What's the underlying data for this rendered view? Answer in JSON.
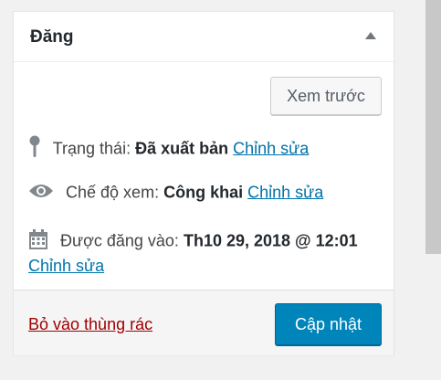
{
  "box": {
    "title": "Đăng",
    "toggle_icon": "triangle-up-icon"
  },
  "actions": {
    "preview_label": "Xem trước"
  },
  "status": {
    "icon": "pin-icon",
    "label": "Trạng thái:",
    "value": "Đã xuất bản",
    "edit_label": "Chỉnh sửa"
  },
  "visibility": {
    "icon": "eye-icon",
    "label": "Chế độ xem:",
    "value": "Công khai",
    "edit_label": "Chỉnh sửa"
  },
  "publish_date": {
    "icon": "calendar-icon",
    "label": "Được đăng vào:",
    "value": "Th10 29, 2018 @ 12:01",
    "edit_label": "Chỉnh sửa"
  },
  "footer": {
    "trash_label": "Bỏ vào thùng rác",
    "update_label": "Cập nhật"
  },
  "colors": {
    "link": "#0073aa",
    "trash": "#a00000",
    "primary": "#0085ba",
    "icon": "#82878c"
  }
}
